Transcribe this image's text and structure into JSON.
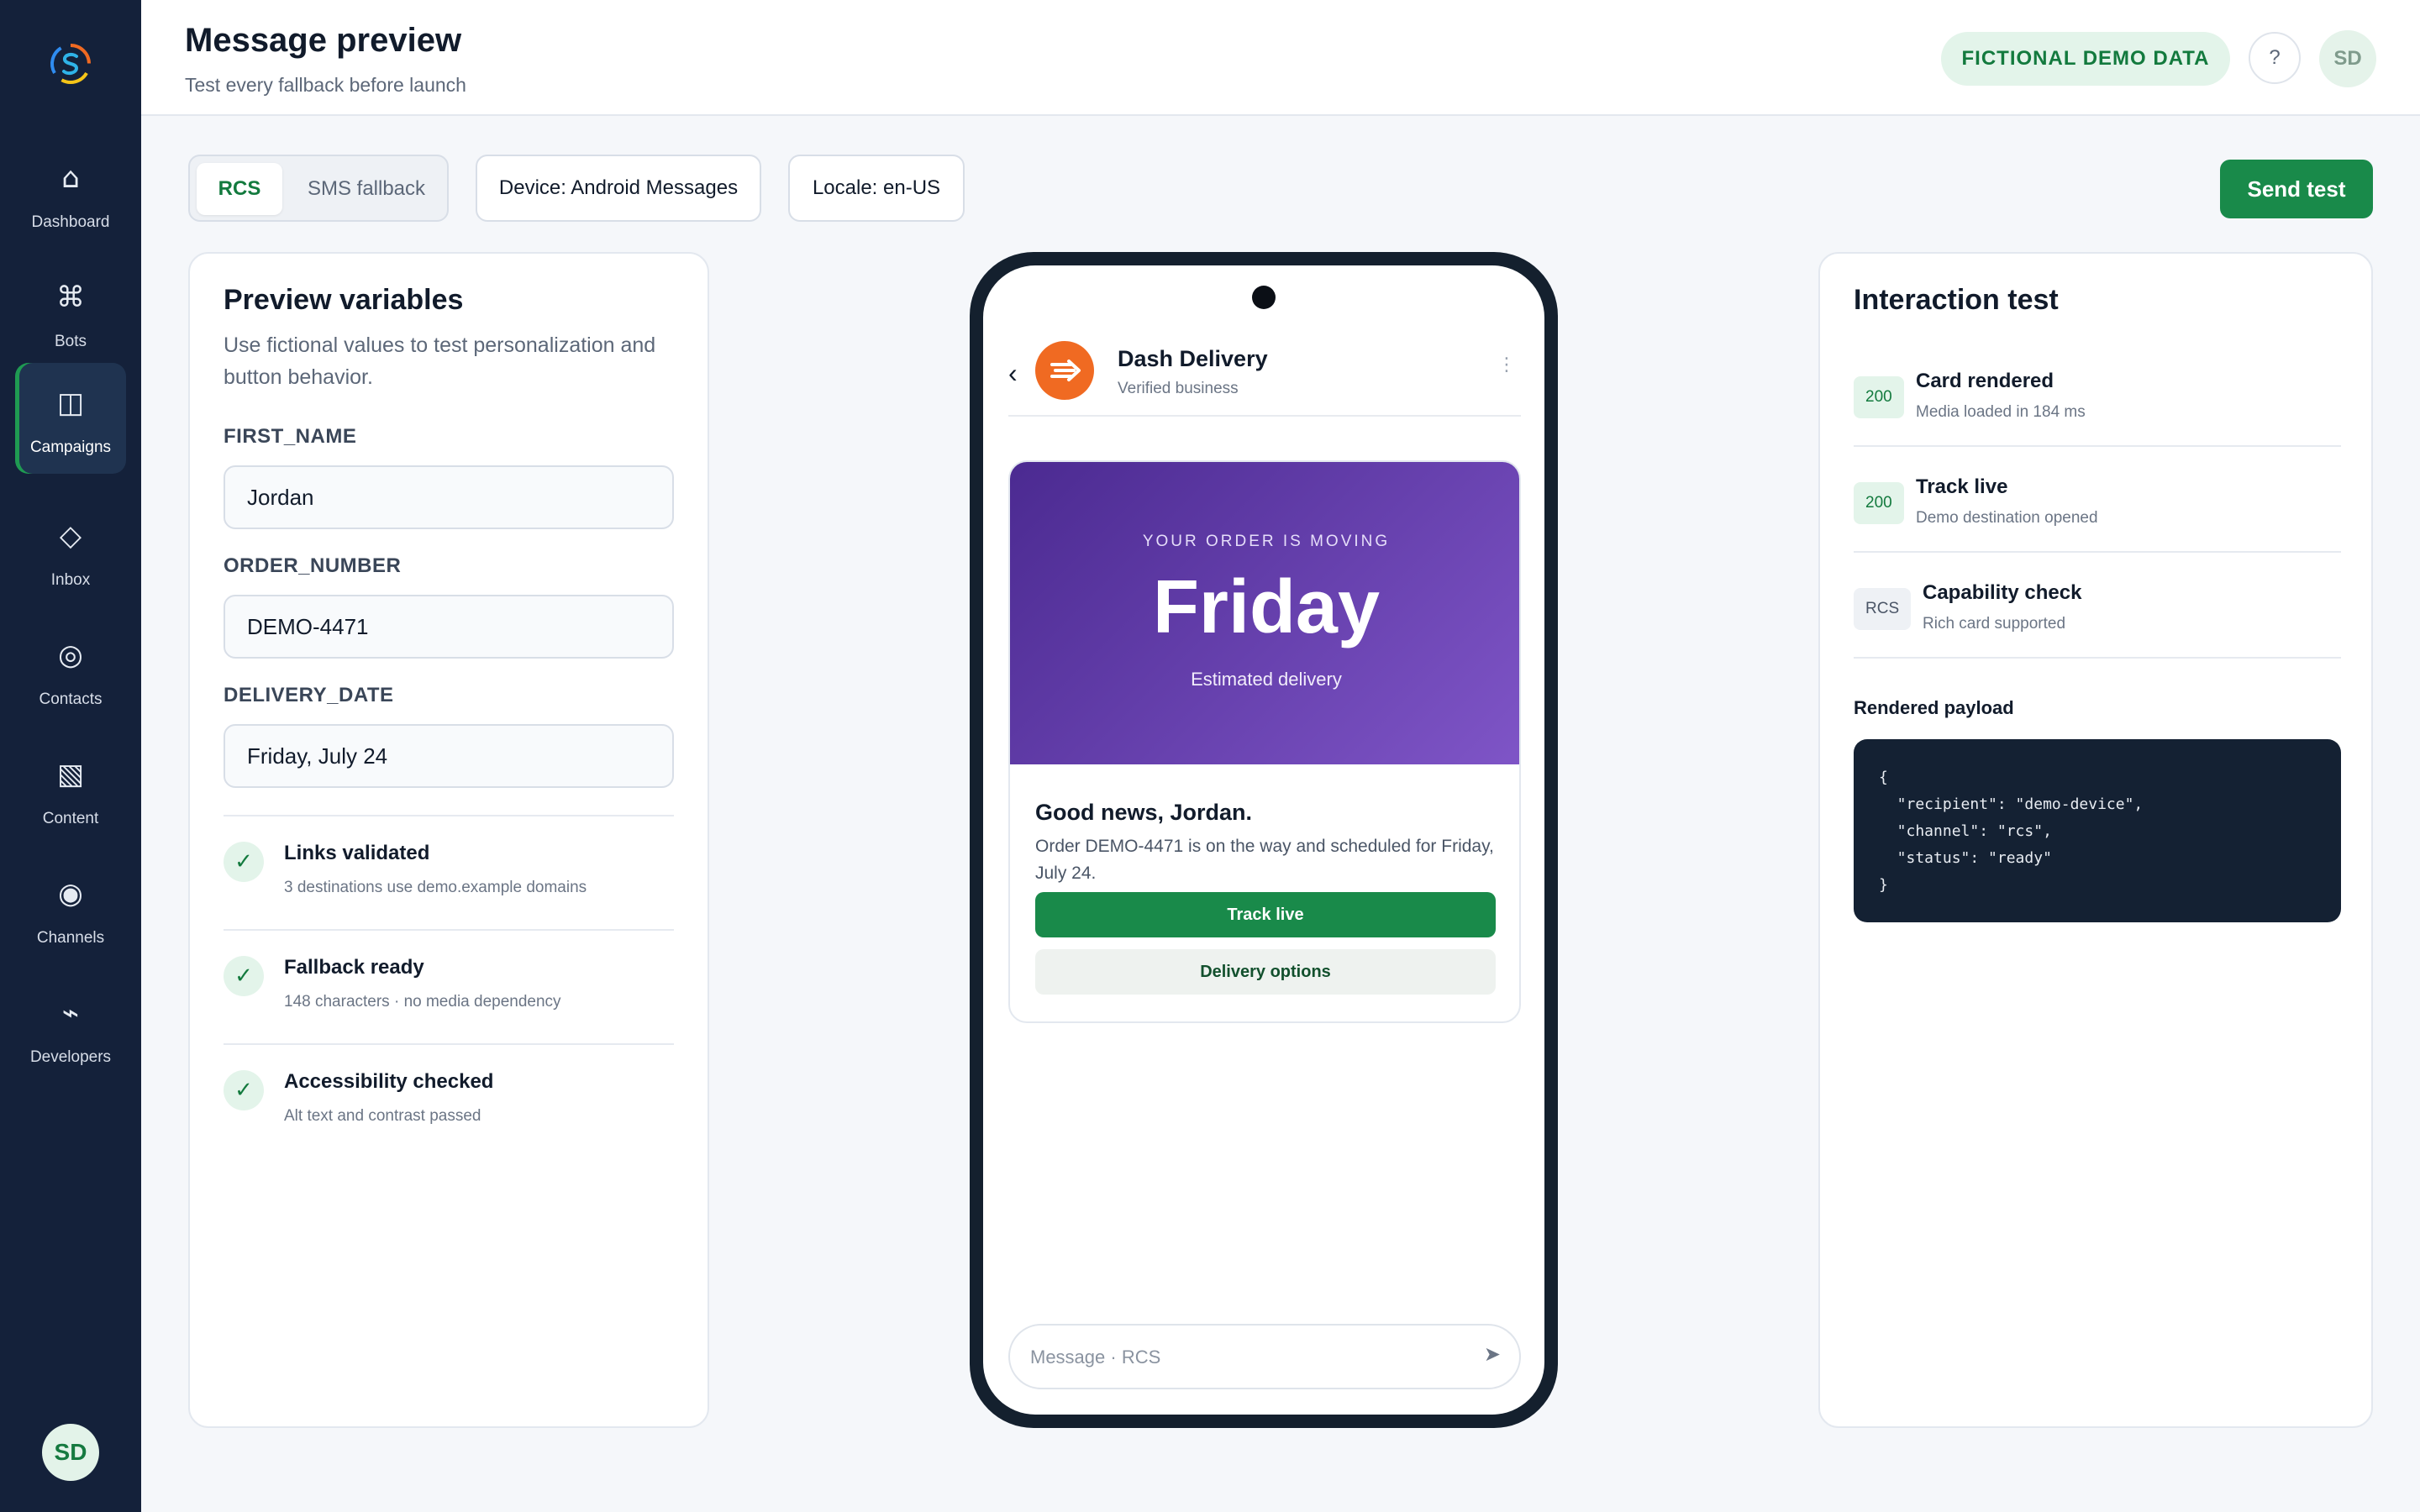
{
  "sidebar": {
    "items": [
      {
        "label": "Dashboard",
        "icon": "⌂"
      },
      {
        "label": "Bots",
        "icon": "⌘"
      },
      {
        "label": "Campaigns",
        "icon": "◫"
      },
      {
        "label": "Inbox",
        "icon": "◇"
      },
      {
        "label": "Contacts",
        "icon": "◎"
      },
      {
        "label": "Content",
        "icon": "▧"
      },
      {
        "label": "Channels",
        "icon": "◉"
      },
      {
        "label": "Developers",
        "icon": "⌁"
      }
    ],
    "active_item": "Campaigns",
    "avatar": "SD"
  },
  "header": {
    "title": "Message preview",
    "subtitle": "Test every fallback before launch",
    "badge": "FICTIONAL DEMO DATA",
    "help": "?",
    "avatar": "SD"
  },
  "toolbar": {
    "channels": [
      "RCS",
      "SMS fallback"
    ],
    "selected_channel": "RCS",
    "device": "Device: Android Messages",
    "locale": "Locale: en-US",
    "send_test": "Send test"
  },
  "variables_panel": {
    "title": "Preview variables",
    "description": "Use fictional values to test personalization and button behavior.",
    "fields": [
      {
        "label": "FIRST_NAME",
        "value": "Jordan"
      },
      {
        "label": "ORDER_NUMBER",
        "value": "DEMO-4471"
      },
      {
        "label": "DELIVERY_DATE",
        "value": "Friday, July 24"
      }
    ],
    "checks": [
      {
        "title": "Links validated",
        "subtitle": "3 destinations use demo.example domains"
      },
      {
        "title": "Fallback ready",
        "subtitle": "148 characters · no media dependency"
      },
      {
        "title": "Accessibility checked",
        "subtitle": "Alt text and contrast passed"
      }
    ],
    "check_mark": "✓"
  },
  "phone": {
    "back": "‹",
    "brand_name": "Dash Delivery",
    "brand_status": "Verified business",
    "menu": "⋮",
    "card": {
      "eyebrow": "YOUR ORDER IS MOVING",
      "headline": "Friday",
      "caption": "Estimated delivery",
      "title": "Good news, Jordan.",
      "body": "Order DEMO-4471 is on the way and scheduled for Friday, July 24.",
      "primary_button": "Track live",
      "secondary_button": "Delivery options"
    },
    "composer_placeholder": "Message · RCS",
    "send": "➤"
  },
  "interaction_panel": {
    "title": "Interaction test",
    "rows": [
      {
        "badge": "200",
        "title": "Card rendered",
        "subtitle": "Media loaded in 184 ms"
      },
      {
        "badge": "200",
        "title": "Track live",
        "subtitle": "Demo destination opened"
      },
      {
        "badge": "RCS",
        "title": "Capability check",
        "subtitle": "Rich card supported"
      }
    ],
    "payload_label": "Rendered payload",
    "payload": "{\n  \"recipient\": \"demo-device\",\n  \"channel\": \"rcs\",\n  \"status\": \"ready\"\n}"
  },
  "colors": {
    "sidebar_bg": "#14213a",
    "accent_green": "#198a4a",
    "brand_orange": "#f06a22",
    "card_purple_start": "#4b2a91",
    "card_purple_end": "#7f55c7"
  }
}
